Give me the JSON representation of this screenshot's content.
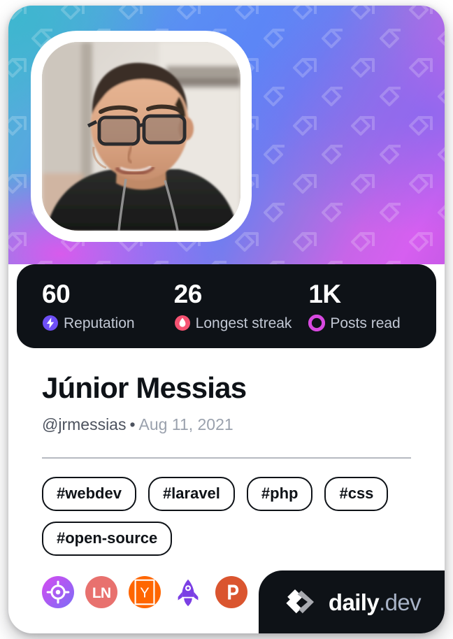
{
  "card": {
    "type": "devcard",
    "brand_accent": "#0e1217",
    "cover_gradient": [
      "#4ab6d4",
      "#5b92f2",
      "#6f7ef0",
      "#c765e8",
      "#d65ff0"
    ]
  },
  "avatar": {
    "alt": "Profile photo of a man with glasses in a dark t-shirt looking down",
    "name": "user-avatar"
  },
  "stats": [
    {
      "value": "60",
      "label": "Reputation",
      "icon": "reputation-bolt-icon",
      "color": "#6e4ff6"
    },
    {
      "value": "26",
      "label": "Longest streak",
      "icon": "streak-flame-icon",
      "color": "#f65272"
    },
    {
      "value": "1K",
      "label": "Posts read",
      "icon": "posts-read-ring-icon",
      "color": "#d849e0"
    }
  ],
  "profile": {
    "name": "Júnior Messias",
    "handle": "@jrmessias",
    "separator": "•",
    "joined": "Aug 11, 2021"
  },
  "tags": [
    "#webdev",
    "#laravel",
    "#php",
    "#css",
    "#open-source"
  ],
  "socials": [
    {
      "name": "target-badge-icon",
      "color": "#a855f7"
    },
    {
      "name": "ln-badge-icon",
      "label": "LN",
      "color": "#e8716e"
    },
    {
      "name": "ycombinator-badge-icon",
      "label": "Y",
      "color": "#ff6600"
    },
    {
      "name": "rocket-badge-icon",
      "color": "#7b3fe4"
    },
    {
      "name": "producthunt-badge-icon",
      "label": "P",
      "color": "#da552f"
    }
  ],
  "brand": {
    "name": "daily",
    "suffix": ".dev",
    "mark": "daily-dev-logo-icon"
  }
}
